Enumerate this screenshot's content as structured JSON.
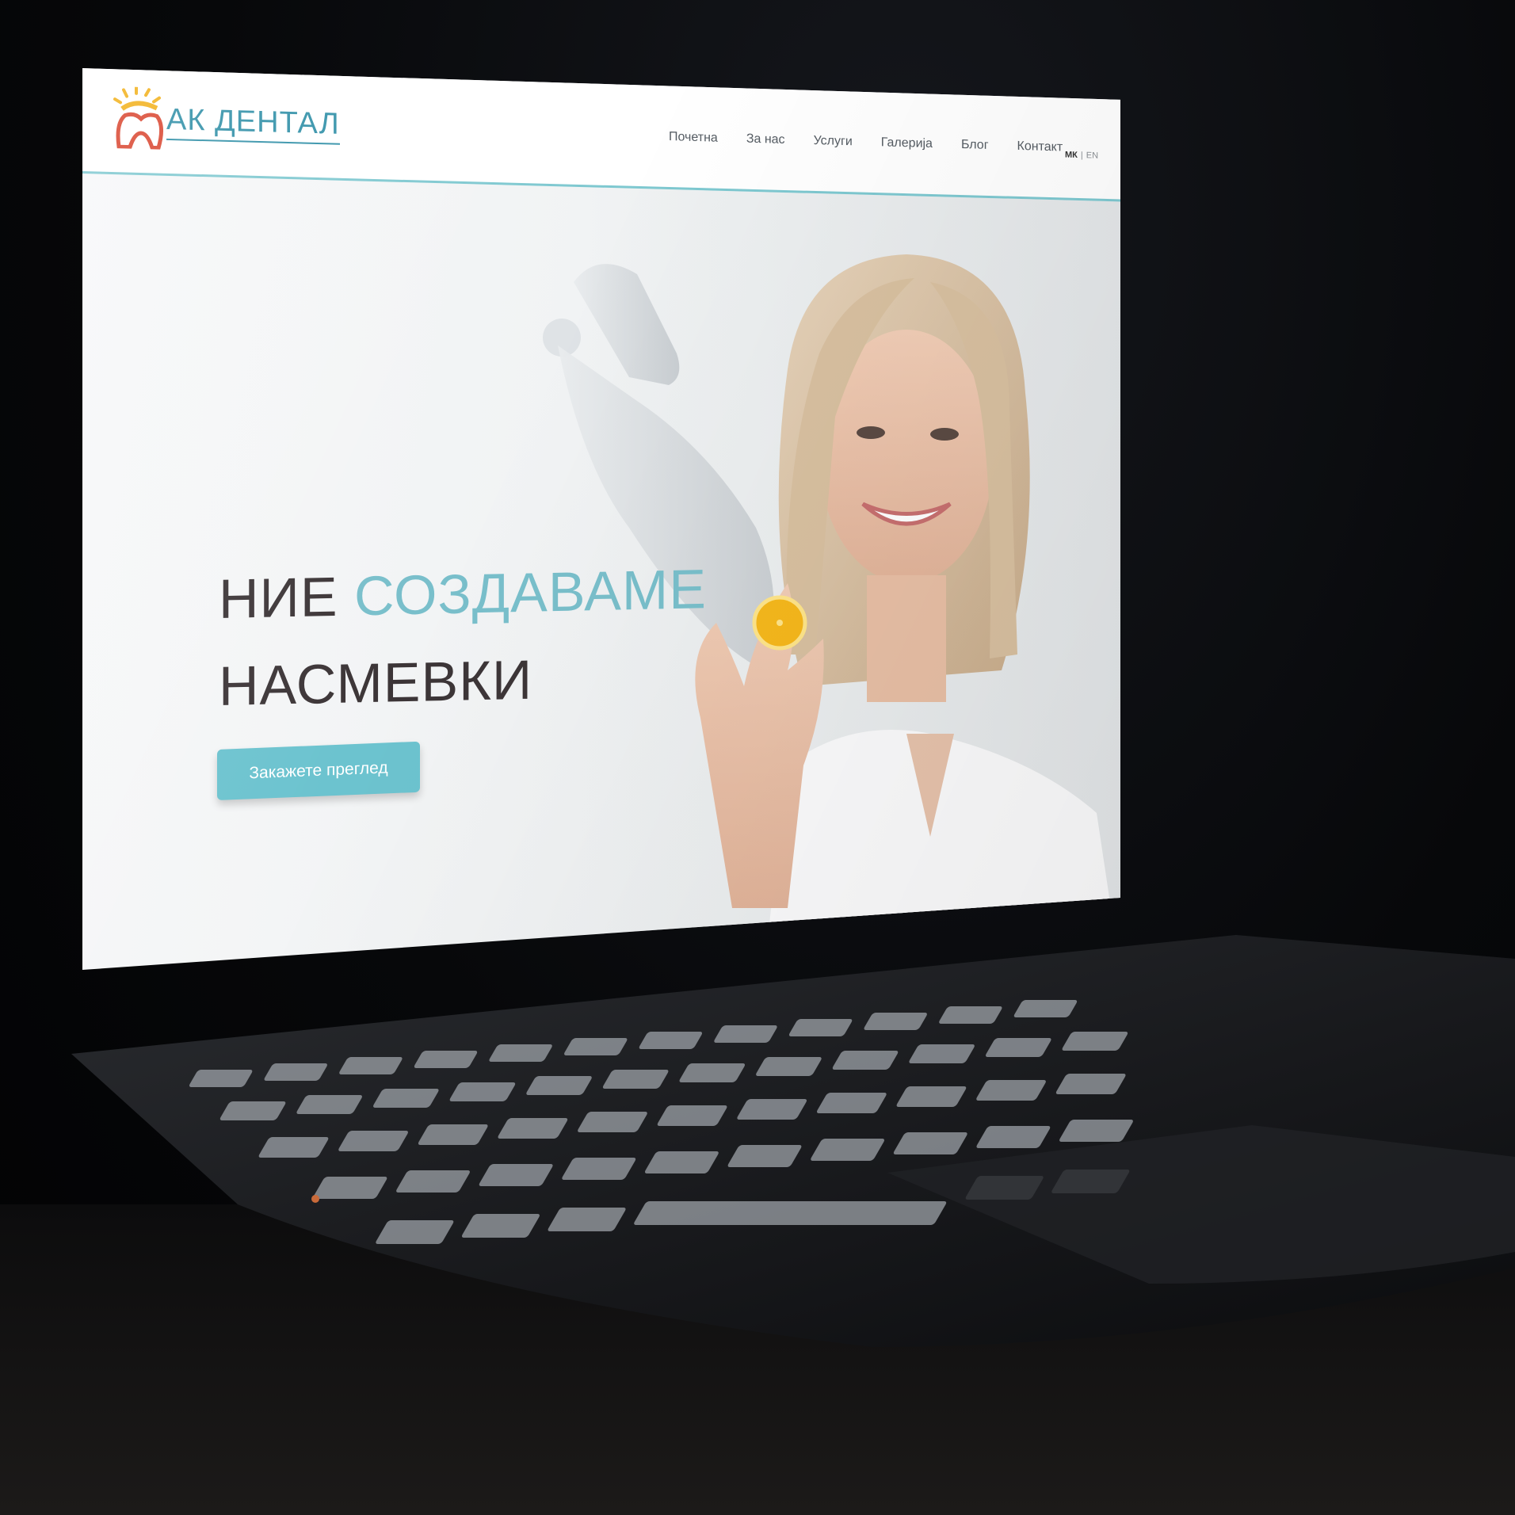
{
  "brand": {
    "logo_text": "АК ДЕНТАЛ"
  },
  "nav": {
    "items": [
      {
        "label": "Почетна"
      },
      {
        "label": "За нас"
      },
      {
        "label": "Услуги"
      },
      {
        "label": "Галерија"
      },
      {
        "label": "Блог"
      },
      {
        "label": "Контакт"
      }
    ],
    "lang_active": "МК",
    "lang_other": "EN"
  },
  "hero": {
    "line1_dark": "НИЕ",
    "line1_accent": "СОЗДАВАМЕ",
    "line2": "НАСМЕВКИ",
    "cta_label": "Закажете преглед"
  },
  "colors": {
    "accent": "#6cc3cf",
    "brand_text": "#2f8fa7",
    "headline": "#3c3537",
    "header_rule": "#7ec8d0"
  }
}
